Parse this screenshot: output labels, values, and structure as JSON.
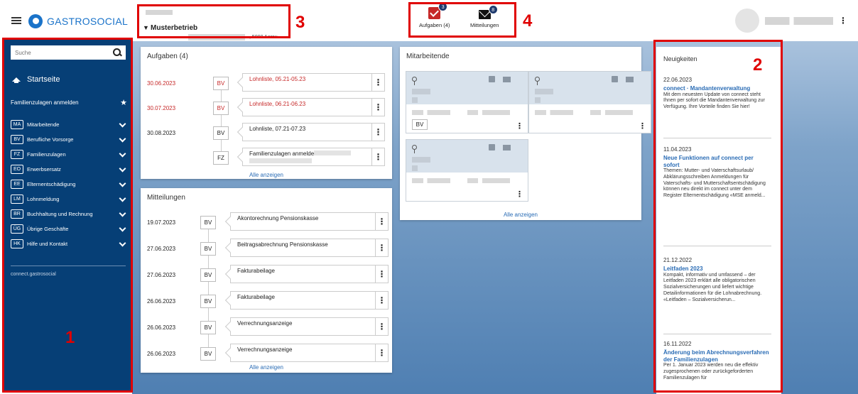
{
  "header": {
    "logo_text": "GASTROSOCIAL",
    "company_name": "Musterbetrieb",
    "company_address": ", 5000 Aarau",
    "tasks_label": "Aufgaben (4)",
    "tasks_count": "3",
    "messages_label": "Mitteilungen",
    "messages_count": "8"
  },
  "annotations": {
    "n1": "1",
    "n2": "2",
    "n3": "3",
    "n4": "4"
  },
  "sidebar": {
    "search_placeholder": "Suche",
    "home_label": "Startseite",
    "family_label": "Familienzulagen anmelden",
    "items": [
      {
        "abbr": "MA",
        "label": "Mitarbeitende"
      },
      {
        "abbr": "BV",
        "label": "Berufliche Vorsorge"
      },
      {
        "abbr": "FZ",
        "label": "Familienzulagen"
      },
      {
        "abbr": "EO",
        "label": "Erwerbsersatz"
      },
      {
        "abbr": "EE",
        "label": "Elternentschädigung"
      },
      {
        "abbr": "LM",
        "label": "Lohnmeldung"
      },
      {
        "abbr": "BR",
        "label": "Buchhaltung und Rechnung"
      },
      {
        "abbr": "ÜG",
        "label": "Übrige Geschäfte"
      },
      {
        "abbr": "HK",
        "label": "Hilfe und Kontakt"
      }
    ],
    "footer": "connect.gastrosocial"
  },
  "tasks": {
    "title": "Aufgaben (4)",
    "rows": [
      {
        "date": "30.06.2023",
        "badge": "BV",
        "text": "Lohnliste, 05.21-05.23",
        "overdue": true
      },
      {
        "date": "30.07.2023",
        "badge": "BV",
        "text": "Lohnliste, 06.21-06.23",
        "overdue": true
      },
      {
        "date": "30.08.2023",
        "badge": "BV",
        "text": "Lohnliste, 07.21-07.23",
        "overdue": false
      },
      {
        "date": "",
        "badge": "FZ",
        "text": "Familienzulagen anmelden",
        "overdue": false
      }
    ],
    "show_all": "Alle anzeigen"
  },
  "messages": {
    "title": "Mitteilungen",
    "rows": [
      {
        "date": "19.07.2023",
        "badge": "BV",
        "text": "Akontorechnung Pensionskasse"
      },
      {
        "date": "27.06.2023",
        "badge": "BV",
        "text": "Beitragsabrechnung Pensionskasse"
      },
      {
        "date": "27.06.2023",
        "badge": "BV",
        "text": "Fakturabeilage"
      },
      {
        "date": "26.06.2023",
        "badge": "BV",
        "text": "Fakturabeilage"
      },
      {
        "date": "26.06.2023",
        "badge": "BV",
        "text": "Verrechnungsanzeige"
      },
      {
        "date": "26.06.2023",
        "badge": "BV",
        "text": "Verrechnungsanzeige"
      }
    ],
    "show_all": "Alle anzeigen"
  },
  "employees": {
    "title": "Mitarbeitende",
    "card1_badge": "BV",
    "show_all": "Alle anzeigen"
  },
  "news": {
    "title": "Neuigkeiten",
    "items": [
      {
        "date": "22.06.2023",
        "headline": "connect · Mandantenverwaltung",
        "text": "Mit dem neuesten Update von connect steht Ihnen per sofort die Mandantenverwaltung zur Verfügung. Ihre Vorteile finden Sie hier!"
      },
      {
        "date": "11.04.2023",
        "headline": "Neue Funktionen auf connect per sofort",
        "text": "Themen: Mutter- und Vaterschaftsurlaub/ Abklärungsschreiben Anmeldungen für Vaterschafts- und Mutterschaftsentschädigung können neu direkt im connect unter dem Register Elternentschädigung «MSE anmeld..."
      },
      {
        "date": "21.12.2022",
        "headline": "Leitfaden 2023",
        "text": "Kompakt, informativ und umfassend – der Leitfaden 2023 erklärt alle obligatorischen Sozialversicherungen und liefert wichtige Detailinformationen für die Lohnabrechnung. «Leitfaden – Sozialversicherun..."
      },
      {
        "date": "16.11.2022",
        "headline": "Änderung beim Abrechnungsverfahren der Familienzulagen",
        "text": "Per 1. Januar 2023 werden neu die effektiv zugesprochenen oder zurückgeforderten Familienzulagen für"
      }
    ]
  },
  "colors": {
    "sidebar_bg": "#063f76",
    "accent": "#1a73c9",
    "alert": "#c62828",
    "annotation": "#e00000"
  }
}
